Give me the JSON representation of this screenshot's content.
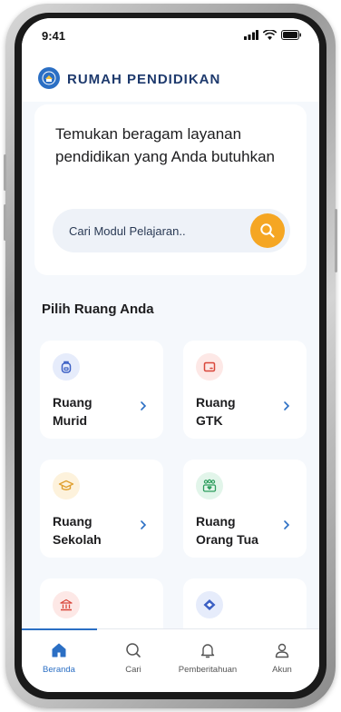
{
  "status_bar": {
    "time": "9:41"
  },
  "header": {
    "logo_text": "RUMAH PENDIDIKAN"
  },
  "hero": {
    "title": "Temukan beragam layanan pendidikan yang Anda butuhkan",
    "search_placeholder": "Cari Modul Pelajaran.."
  },
  "section": {
    "title": "Pilih Ruang Anda"
  },
  "tiles": [
    {
      "line1": "Ruang",
      "line2": "Murid",
      "icon": "backpack-icon"
    },
    {
      "line1": "Ruang",
      "line2": "GTK",
      "icon": "board-icon"
    },
    {
      "line1": "Ruang",
      "line2": "Sekolah",
      "icon": "graduation-cap-icon"
    },
    {
      "line1": "Ruang",
      "line2": "Orang Tua",
      "icon": "family-icon"
    },
    {
      "line1": "",
      "line2": "",
      "icon": "building-icon"
    },
    {
      "line1": "",
      "line2": "",
      "icon": "handshake-icon"
    }
  ],
  "nav": [
    {
      "label": "Beranda",
      "icon": "home-icon",
      "active": true
    },
    {
      "label": "Cari",
      "icon": "search-icon",
      "active": false
    },
    {
      "label": "Pemberitahuan",
      "icon": "bell-icon",
      "active": false
    },
    {
      "label": "Akun",
      "icon": "user-icon",
      "active": false
    }
  ],
  "colors": {
    "brand_blue": "#2b6fc4",
    "search_button": "#f5a623",
    "background": "#f5f8fc"
  }
}
